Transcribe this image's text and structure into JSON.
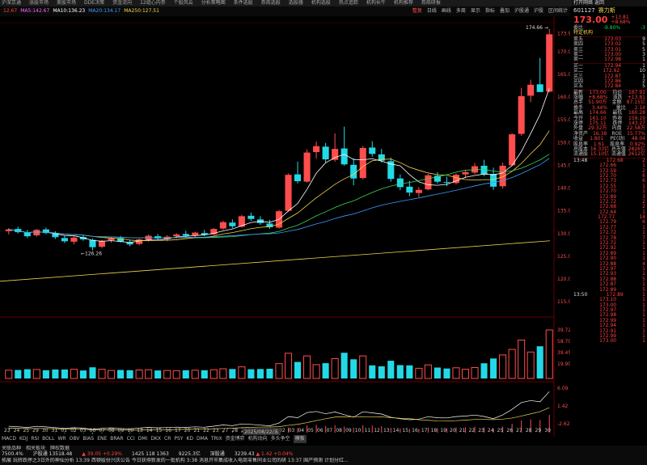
{
  "menubar": [
    "沪深京通",
    "涨股市场",
    "美股市场",
    "DDE决策",
    "资金流向",
    "12组心内参",
    "个股风云",
    "分析策略图",
    "条件选股",
    "券商选股",
    "选股器",
    "机构选股",
    "热点追踪",
    "机构长牛",
    "机构推荐",
    "券商研报"
  ],
  "toolbar": {
    "tag": "12.67",
    "ma5": "MA5:142.67",
    "ma10": "MA10:136.23",
    "ma20": "MA20:134.17",
    "ma250": "MA250:127.51",
    "buttons": [
      "整复",
      "日线",
      "画线",
      "多周",
      "显示",
      "指标",
      "叠加",
      "沪股通",
      "沪股",
      "区间统计"
    ],
    "right_buttons": [
      "分时",
      "打开网络",
      "返回"
    ]
  },
  "chart_data": {
    "type": "candlestick",
    "price_axis_ticks": [
      173.93,
      170,
      165,
      160,
      155,
      150,
      145,
      140,
      135,
      130,
      125,
      120,
      115
    ],
    "high_label": "174.66",
    "low_label": "126.26",
    "candles": [
      [
        130.5,
        131.2,
        129.8,
        130.9
      ],
      [
        131.0,
        131.5,
        130.0,
        130.3
      ],
      [
        130.2,
        130.8,
        129.0,
        129.4
      ],
      [
        129.6,
        131.0,
        129.3,
        130.8
      ],
      [
        130.9,
        131.3,
        129.9,
        130.1
      ],
      [
        130.0,
        130.5,
        128.8,
        129.2
      ],
      [
        129.0,
        129.6,
        127.9,
        128.3
      ],
      [
        128.2,
        129.4,
        127.6,
        129.1
      ],
      [
        129.2,
        129.7,
        128.4,
        128.7
      ],
      [
        128.6,
        128.9,
        126.3,
        127.0
      ],
      [
        127.1,
        128.6,
        126.8,
        128.4
      ],
      [
        128.5,
        129.3,
        128.0,
        128.9
      ],
      [
        129.0,
        129.5,
        128.0,
        128.2
      ],
      [
        128.1,
        128.6,
        127.2,
        127.6
      ],
      [
        127.7,
        128.9,
        127.4,
        128.7
      ],
      [
        128.6,
        129.8,
        128.2,
        129.5
      ],
      [
        129.4,
        129.9,
        128.6,
        128.9
      ],
      [
        128.8,
        129.6,
        128.3,
        129.3
      ],
      [
        129.4,
        130.1,
        128.9,
        129.8
      ],
      [
        129.9,
        130.6,
        129.2,
        129.5
      ],
      [
        129.6,
        130.4,
        129.0,
        130.2
      ],
      [
        130.1,
        130.8,
        129.4,
        129.7
      ],
      [
        129.8,
        131.2,
        129.6,
        131.0
      ],
      [
        131.1,
        132.8,
        130.8,
        132.5
      ],
      [
        132.4,
        133.1,
        131.2,
        131.6
      ],
      [
        131.5,
        134.1,
        131.3,
        133.8
      ],
      [
        133.9,
        134.6,
        132.8,
        133.2
      ],
      [
        133.1,
        133.8,
        131.9,
        132.3
      ],
      [
        132.2,
        133.0,
        131.0,
        131.4
      ],
      [
        131.3,
        135.2,
        131.1,
        134.9
      ],
      [
        135.0,
        143.2,
        134.8,
        142.9
      ],
      [
        143.0,
        145.8,
        141.0,
        141.5
      ],
      [
        141.4,
        148.5,
        141.2,
        147.8
      ],
      [
        147.9,
        150.2,
        146.5,
        149.2
      ],
      [
        149.1,
        149.9,
        145.6,
        146.3
      ],
      [
        146.2,
        152.0,
        145.8,
        148.6
      ],
      [
        148.7,
        153.5,
        144.9,
        145.2
      ],
      [
        145.1,
        146.5,
        140.6,
        142.1
      ],
      [
        142.2,
        149.2,
        141.9,
        148.8
      ],
      [
        148.9,
        150.3,
        146.9,
        147.5
      ],
      [
        147.4,
        148.6,
        145.6,
        146.0
      ],
      [
        145.9,
        146.7,
        141.4,
        142.0
      ],
      [
        142.1,
        143.0,
        139.5,
        140.2
      ],
      [
        140.3,
        141.6,
        138.2,
        139.0
      ],
      [
        138.9,
        140.2,
        138.0,
        139.6
      ],
      [
        139.7,
        143.1,
        139.5,
        142.8
      ],
      [
        142.7,
        143.5,
        141.0,
        141.4
      ],
      [
        141.3,
        142.5,
        140.4,
        141.2
      ],
      [
        141.1,
        143.2,
        140.8,
        142.9
      ],
      [
        143.0,
        144.0,
        142.2,
        143.5
      ],
      [
        143.4,
        145.5,
        143.0,
        144.8
      ],
      [
        144.9,
        146.2,
        142.6,
        143.0
      ],
      [
        143.1,
        144.5,
        139.6,
        140.3
      ],
      [
        140.4,
        145.6,
        139.9,
        144.9
      ],
      [
        145.0,
        152.1,
        144.8,
        151.8
      ],
      [
        151.9,
        162.0,
        151.5,
        160.2
      ],
      [
        160.3,
        163.8,
        158.9,
        162.7
      ],
      [
        162.8,
        168.6,
        162.0,
        161.1
      ],
      [
        161.2,
        175.0,
        161.0,
        173.8
      ]
    ],
    "volume_axis_ticks": [
      "39.72",
      "58.70",
      "39.45",
      "19.90"
    ],
    "dates": [
      "23",
      "24",
      "25",
      "29",
      "30",
      "31",
      "01",
      "02",
      "03",
      "06",
      "07",
      "08",
      "09",
      "10",
      "13",
      "14",
      "15",
      "16",
      "17",
      "20",
      "21",
      "22",
      "23",
      "27",
      "28",
      "29",
      "30",
      "31",
      "01",
      "02",
      "03",
      "04",
      "05",
      "06",
      "07",
      "08",
      "09",
      "10",
      "11",
      "12",
      "13",
      "14",
      "15",
      "16",
      "17",
      "18",
      "19",
      "20",
      "21",
      "22",
      "23",
      "24",
      "25",
      "26",
      "27",
      "28",
      "29",
      "30"
    ],
    "date_label": "2025/08/22/五"
  },
  "indicator_tabs": [
    "MACD",
    "KDJ",
    "RSI",
    "BOLL",
    "WR",
    "OBV",
    "BIAS",
    "ENE",
    "BRAR",
    "CCI",
    "DMI",
    "DKX",
    "CR",
    "PSY",
    "KD",
    "DMA",
    "TRIX",
    "资金博弈",
    "机构动向",
    "多头争空",
    "模板"
  ],
  "right_panel": {
    "code": "601127",
    "name": "赛力斯",
    "price": "173.00",
    "change": "+13.81",
    "pct": "+8.68%",
    "header_labels": [
      "打开网络",
      "返回"
    ],
    "ratio_label": "委比",
    "ratio_value": "-9.80%",
    "ratio_diff": "-3",
    "news_label": "特定机构",
    "asks": [
      [
        "卖五",
        "173.03",
        "9"
      ],
      [
        "卖四",
        "173.02",
        "5"
      ],
      [
        "卖三",
        "173.01",
        "5"
      ],
      [
        "卖二",
        "173.00",
        "3"
      ],
      [
        "卖一",
        "172.98",
        "1"
      ]
    ],
    "bids": [
      [
        "买一",
        "172.94",
        "1"
      ],
      [
        "买二",
        "172.92",
        "10"
      ],
      [
        "买三",
        "172.87",
        "1"
      ],
      [
        "买四",
        "172.86",
        "2"
      ],
      [
        "买五",
        "172.84",
        "5"
      ]
    ],
    "stats": [
      [
        "最新",
        "173.00",
        "均价",
        "167.91"
      ],
      [
        "涨幅",
        "+8.68%",
        "涨跌",
        "+13.81"
      ],
      [
        "总手",
        "51.90万",
        "金额",
        "87.15亿"
      ],
      [
        "换手",
        "3.44%",
        "量比",
        "2.14"
      ],
      [
        "最高",
        "174.66",
        "最低",
        "160.28"
      ],
      [
        "今开",
        "161.10",
        "昨收",
        "159.19"
      ],
      [
        "涨停",
        "175.11",
        "跌停",
        "143.27"
      ],
      [
        "外盘",
        "29.32万",
        "内盘",
        "22.58万"
      ],
      [
        "净资产",
        "16.38",
        "ROE",
        "15.77%"
      ],
      [
        "收益",
        "1.801",
        "PE(动)",
        "48.04"
      ],
      [
        "股息率",
        "1.61",
        "股息率",
        "0.92%"
      ],
      [
        "总股本",
        "16.33亿",
        "总市值",
        "2826亿"
      ],
      [
        "流通股",
        "15.10亿",
        "流通值",
        "2612亿"
      ]
    ],
    "ticks": [
      [
        "13:48",
        "172.68",
        "2"
      ],
      [
        "",
        "172.66",
        "1"
      ],
      [
        "",
        "172.59",
        "2"
      ],
      [
        "",
        "172.70",
        "6"
      ],
      [
        "",
        "172.73",
        "6"
      ],
      [
        "",
        "172.55",
        "1"
      ],
      [
        "",
        "172.70",
        "1"
      ],
      [
        "",
        "172.89",
        "3"
      ],
      [
        "",
        "172.72",
        "2"
      ],
      [
        "",
        "172.68",
        "2"
      ],
      [
        "",
        "172.64",
        "1"
      ],
      [
        "",
        "172.77",
        "14"
      ],
      [
        "",
        "172.79",
        "6"
      ],
      [
        "",
        "172.77",
        "1"
      ],
      [
        "",
        "172.72",
        "1"
      ],
      [
        "",
        "172.78",
        "7"
      ],
      [
        "",
        "172.72",
        "1"
      ],
      [
        "",
        "172.92",
        "1"
      ],
      [
        "",
        "172.89",
        "1"
      ],
      [
        "",
        "172.90",
        "1"
      ],
      [
        "",
        "172.88",
        "4"
      ],
      [
        "",
        "172.97",
        "1"
      ],
      [
        "",
        "172.93",
        "1"
      ],
      [
        "",
        "172.88",
        "5"
      ],
      [
        "",
        "172.87",
        "1"
      ],
      [
        "",
        "172.89",
        "5"
      ],
      [
        "13:50",
        "172.89",
        "1"
      ],
      [
        "",
        "173.10",
        "1"
      ],
      [
        "",
        "173.00",
        "1"
      ],
      [
        "",
        "172.97",
        "1"
      ],
      [
        "",
        "172.98",
        "1"
      ],
      [
        "",
        "172.99",
        "1"
      ],
      [
        "",
        "172.94",
        "1"
      ],
      [
        "",
        "172.91",
        "1"
      ],
      [
        "",
        "172.99",
        "1"
      ],
      [
        "",
        "173.00",
        "1"
      ]
    ]
  },
  "bottom": {
    "tabs": [
      "关联品种",
      "相关板块",
      "牌权数据"
    ],
    "index_row": [
      [
        "",
        "7500.4%",
        ""
      ],
      [
        "沪股通",
        "13518.48",
        ""
      ],
      [
        "▲ 39.05",
        "+0.29%",
        ""
      ],
      [
        "1425",
        "118",
        "1363"
      ],
      [
        "9225.3亿",
        ""
      ],
      [
        "深股通",
        "",
        ""
      ],
      [
        "3239.43",
        "▲ 1.42",
        "+0.04%"
      ]
    ],
    "news": "拓展  玩转跌停之3日外的神仙分析 13:39 西顿股份兴庆公告 今日获得新发的一批机构 3:38 消息开市集成收入电商零售同业公司的研 13:37 国产预测 计划分红..."
  }
}
